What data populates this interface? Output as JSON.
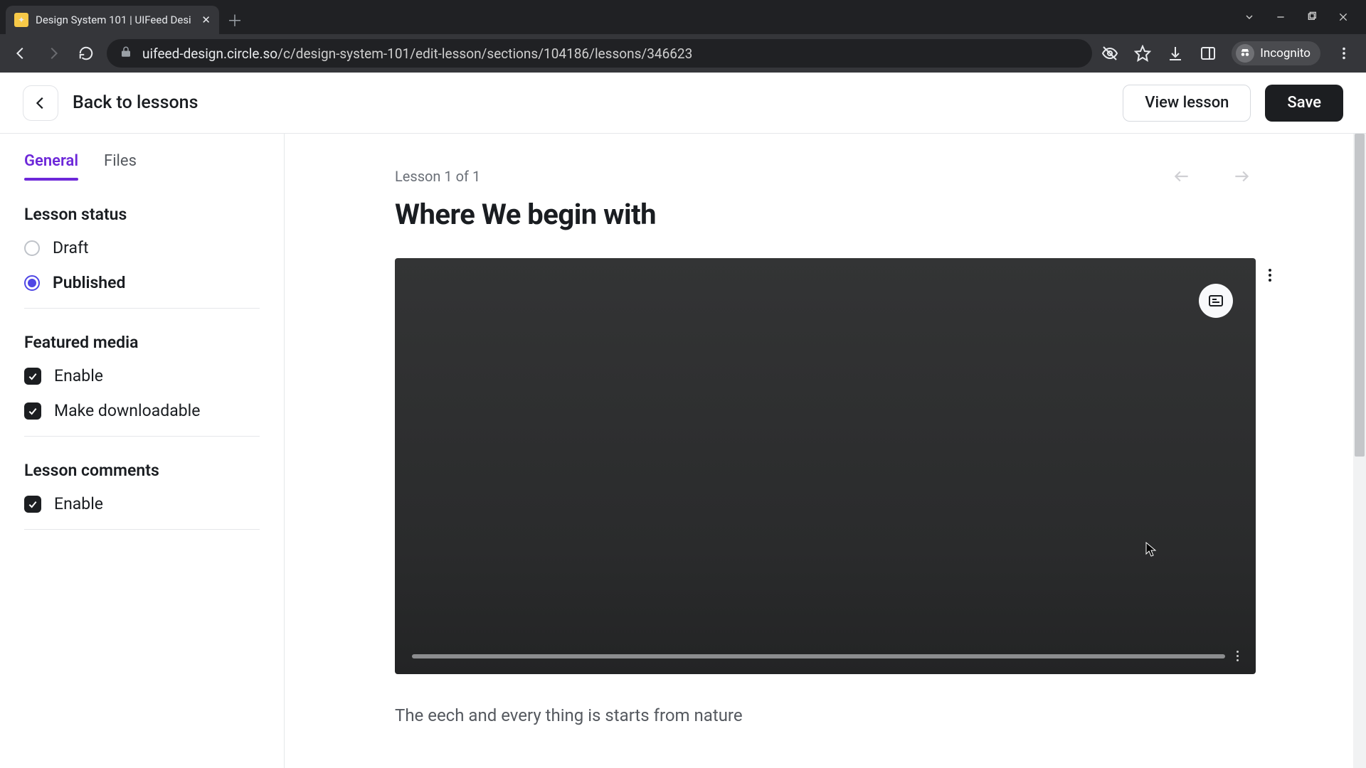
{
  "chrome": {
    "tab_title": "Design System 101 | UIFeed Desi",
    "incognito_label": "Incognito",
    "url_host": "uifeed-design.circle.so",
    "url_path": "/c/design-system-101/edit-lesson/sections/104186/lessons/346623"
  },
  "header": {
    "back_label": "Back to lessons",
    "view_button": "View lesson",
    "save_button": "Save"
  },
  "tabs": {
    "general": "General",
    "files": "Files"
  },
  "sidebar": {
    "status_title": "Lesson status",
    "status_options": {
      "draft": "Draft",
      "published": "Published"
    },
    "featured_title": "Featured media",
    "featured_options": {
      "enable": "Enable",
      "downloadable": "Make downloadable"
    },
    "comments_title": "Lesson comments",
    "comments_options": {
      "enable": "Enable"
    }
  },
  "lesson": {
    "position": "Lesson 1 of 1",
    "title": "Where We begin with",
    "body_1": "The eech and every thing is starts from nature"
  }
}
